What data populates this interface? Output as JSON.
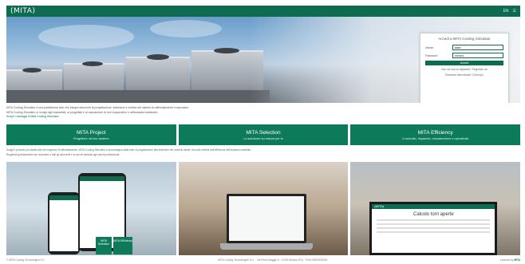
{
  "header": {
    "logo": "(MITA)",
    "right_items": [
      "EN",
      "☰"
    ]
  },
  "login": {
    "title": "Accedi a MITA Cooling Simulator",
    "user_label": "Utente",
    "user_value": "user",
    "password_label": "Password",
    "password_value": "••••••••",
    "submit_label": "Accedi",
    "link1": "Non sei ancora registrato? Registrati ora",
    "link2": "Password dimenticata? Clicca qui"
  },
  "intro": {
    "line1": "MITA Cooling Simulator è una piattaforma web che integra strumenti di progettazione, selezione e verifica dei sistemi di raffreddamento evaporativo.",
    "line2": "MITA Cooling Simulator si rivolge agli impiantisti, ai progettisti e ai manutentori di torri evaporative e raffreddatori adiabatici.",
    "link": "Scopri i vantaggi di Mita Cooling Simulator"
  },
  "tiles": [
    {
      "title": "MITA Project",
      "subtitle": "Progettare nel tuo cantiere"
    },
    {
      "title": "MITA Selection",
      "subtitle": "La soluzione su misura per te"
    },
    {
      "title": "MITA Efficiency",
      "subtitle": "Il controllo, risparmio, manutenzione e operatività"
    }
  ],
  "desc": {
    "line1": "Scegli il prodotto più adatto alle tue esigenze di raffreddamento: MITA Cooling Simulator ti accompagna dalla fase di progettazione alla selezione del modello ideale, fino alla verifica dell'efficienza dell'impianto installato.",
    "line2": "Registrati gratuitamente per accedere a tutti gli strumenti e ai servizi dedicati agli utenti professionali."
  },
  "panel_screens": {
    "phone_tile1": "MITA Selection",
    "phone_tile2": "MITA Efficiency",
    "monitor_bar": "(MITA)",
    "monitor_title": "Calcolo torri aperte"
  },
  "footer": {
    "left": "© MITA Cooling Technologies S.r.l.",
    "center": "MITA Cooling Technologies S.r.l. · Via Primo Maggio 5 · 27019 Siziano (PV) · P.IVA 00000000000",
    "right_prefix": "powered by",
    "right_brand": "MITA"
  },
  "colors": {
    "primary": "#0d6b4f",
    "tile": "#0d7b5a"
  }
}
